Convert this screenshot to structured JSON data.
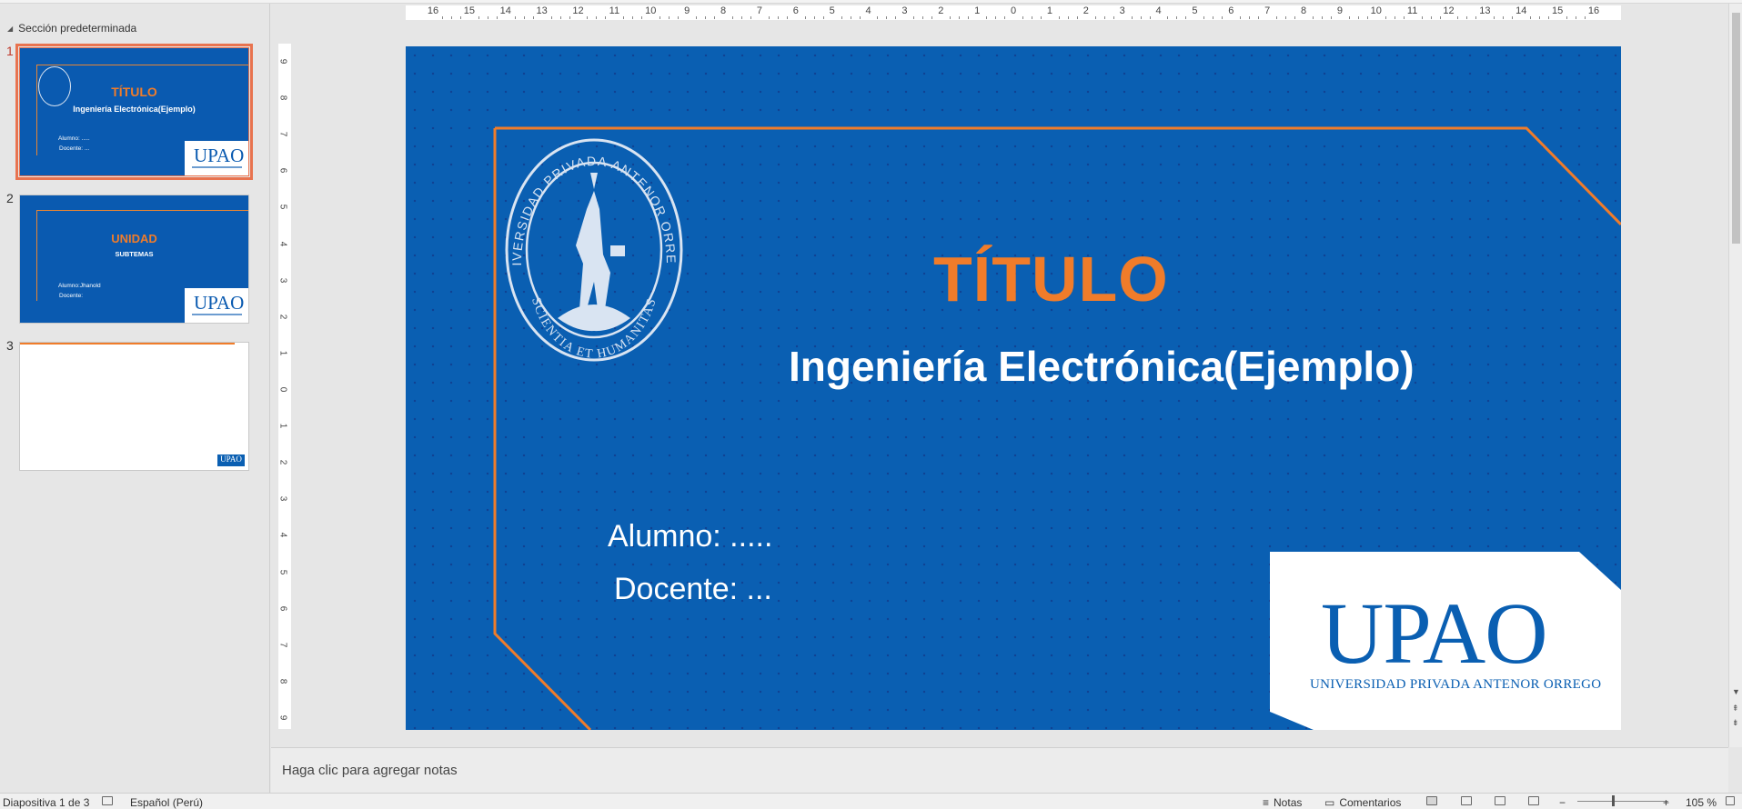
{
  "thumbnails": {
    "section_label": "Sección predeterminada",
    "slides": [
      {
        "number": "1",
        "title": "TÍTULO",
        "subtitle": "Ingeniería Electrónica(Ejemplo)",
        "line1": "Alumno: .....",
        "line2": "Docente: ...",
        "logo": "UPAO"
      },
      {
        "number": "2",
        "title": "UNIDAD",
        "subtitle": "SUBTEMAS",
        "line1": "Alumno:Jhanold",
        "line2": "Docente:",
        "logo": "UPAO"
      },
      {
        "number": "3",
        "logo": "UPAO"
      }
    ]
  },
  "ruler": {
    "horizontal": [
      "16",
      "15",
      "14",
      "13",
      "12",
      "11",
      "10",
      "9",
      "8",
      "7",
      "6",
      "5",
      "4",
      "3",
      "2",
      "1",
      "0",
      "1",
      "2",
      "3",
      "4",
      "5",
      "6",
      "7",
      "8",
      "9",
      "10",
      "11",
      "12",
      "13",
      "14",
      "15",
      "16"
    ],
    "vertical": [
      "9",
      "8",
      "7",
      "6",
      "5",
      "4",
      "3",
      "2",
      "1",
      "0",
      "1",
      "2",
      "3",
      "4",
      "5",
      "6",
      "7",
      "8",
      "9"
    ]
  },
  "slide": {
    "title": "TÍTULO",
    "subtitle": "Ingeniería Electrónica(Ejemplo)",
    "student_label": "Alumno: .....",
    "teacher_label": "Docente: ...",
    "seal_top_text": "UNIVERSIDAD PRIVADA ANTENOR ORREGO",
    "seal_bottom_text": "SCIENTIA ET HUMANITAS",
    "logo_main": "UPAO",
    "logo_sub": "UNIVERSIDAD PRIVADA ANTENOR ORREGO",
    "colors": {
      "background": "#0a5fb2",
      "accent": "#f07c2a",
      "text": "#ffffff"
    }
  },
  "notes": {
    "placeholder": "Haga clic para agregar notas"
  },
  "status": {
    "slide_counter": "Diapositiva 1 de 3",
    "language": "Español (Perú)",
    "notes_label": "Notas",
    "comments_label": "Comentarios",
    "zoom": "105 %",
    "zoom_minus": "−",
    "zoom_plus": "+"
  }
}
